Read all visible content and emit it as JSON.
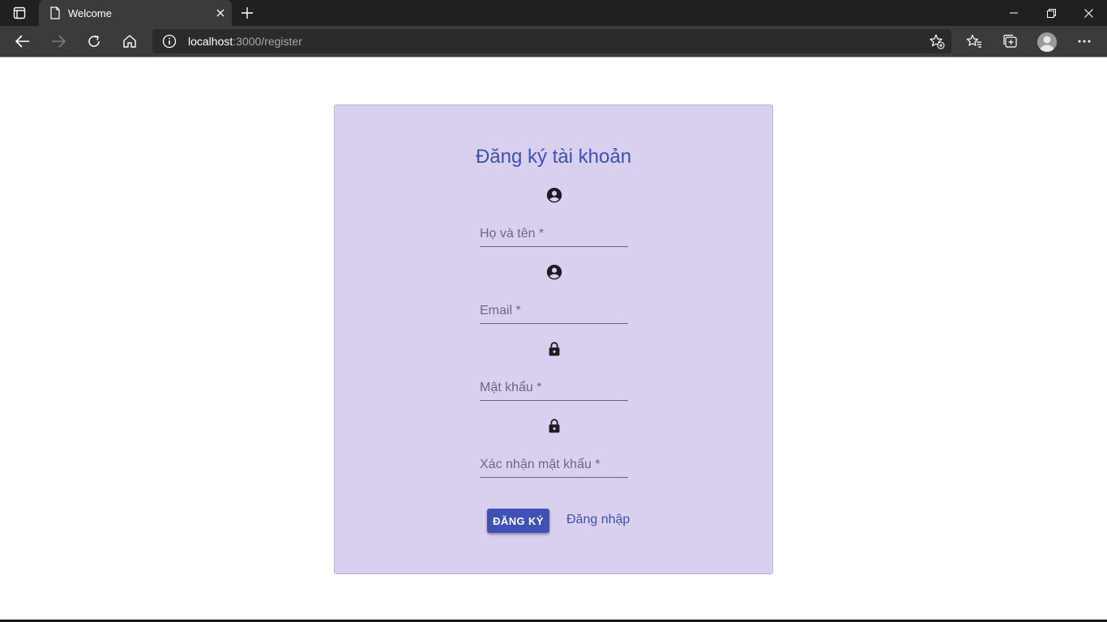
{
  "browser": {
    "tab_title": "Welcome",
    "url_host": "localhost",
    "url_path": ":3000/register"
  },
  "form": {
    "heading": "Đăng ký tài khoản",
    "fields": [
      {
        "placeholder": "Họ và tên *",
        "icon": "account-circle-icon"
      },
      {
        "placeholder": "Email *",
        "icon": "account-circle-icon"
      },
      {
        "placeholder": "Mật khẩu *",
        "icon": "lock-icon"
      },
      {
        "placeholder": "Xác nhận mật khẩu *",
        "icon": "lock-icon"
      }
    ],
    "submit_label": "ĐĂNG KÝ",
    "login_link": "Đăng nhập"
  },
  "colors": {
    "card_bg": "#d9cfee",
    "accent": "#3f51b5",
    "chrome_dark": "#202020",
    "chrome_toolbar": "#3b3b3b"
  }
}
